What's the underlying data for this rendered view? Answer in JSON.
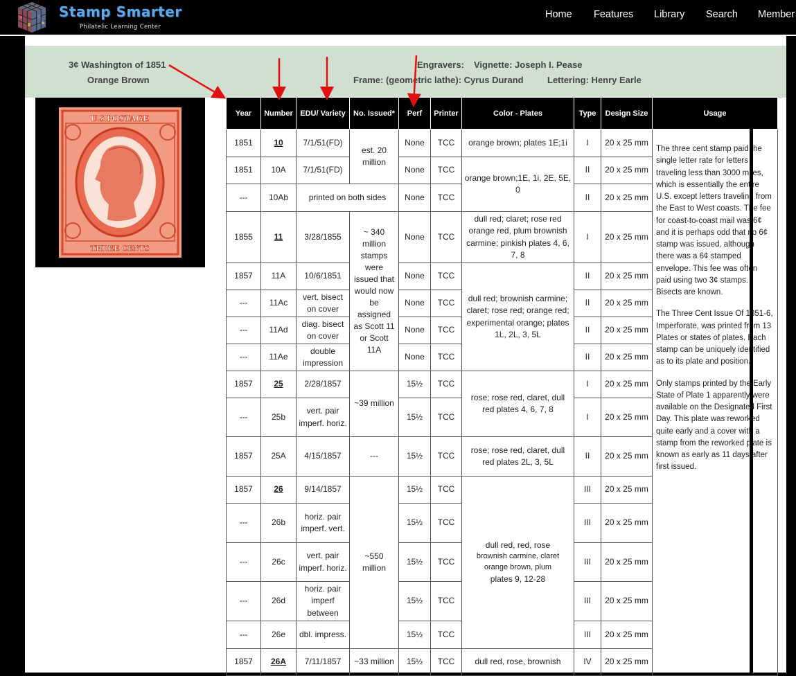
{
  "nav": {
    "brand": "Stamp Smarter",
    "tagline": "Philatelic Learning Center",
    "menu": [
      "Home",
      "Features",
      "Library",
      "Search",
      "Member"
    ]
  },
  "header": {
    "stamp_title": "3¢ Washington of 1851",
    "stamp_color": "Orange Brown",
    "engravers_label": "Engravers:",
    "vignette": "Vignette: Joseph I. Pease",
    "frame": "Frame: (geometric lathe): Cyrus Durand",
    "lettering": "Lettering: Henry Earle"
  },
  "stamp_image": {
    "top_text": "U.S.POSTAGE",
    "bottom_text": "THREE CENTS"
  },
  "table": {
    "headers": [
      "Year",
      "Number",
      "EDU/ Variety",
      "No. Issued*",
      "Perf",
      "Printer",
      "Color - Plates",
      "Type",
      "Design Size",
      "Usage"
    ],
    "rows": [
      {
        "year": "1851",
        "number": "10",
        "edu": "7/1/51(FD)",
        "perf": "None",
        "printer": "TCC",
        "type": "I",
        "size": "20 x 25 mm"
      },
      {
        "year": "1851",
        "number": "10A",
        "edu": "7/1/51(FD)",
        "perf": "None",
        "printer": "TCC",
        "type": "II",
        "size": "20 x 25 mm"
      },
      {
        "year": "---",
        "number": "10Ab",
        "edu": "printed on both sides",
        "perf": "None",
        "printer": "TCC",
        "type": "II",
        "size": "20 x 25 mm"
      },
      {
        "year": "1855",
        "number": "11",
        "edu": "3/28/1855",
        "perf": "None",
        "printer": "TCC",
        "type": "I",
        "size": "20 x 25 mm"
      },
      {
        "year": "1857",
        "number": "11A",
        "edu": "10/6/1851",
        "perf": "None",
        "printer": "TCC",
        "type": "II",
        "size": "20 x 25 mm"
      },
      {
        "year": "---",
        "number": "11Ac",
        "edu": "vert. bisect on cover",
        "perf": "None",
        "printer": "TCC",
        "type": "II",
        "size": "20 x 25 mm"
      },
      {
        "year": "---",
        "number": "11Ad",
        "edu": "diag. bisect on cover",
        "perf": "None",
        "printer": "TCC",
        "type": "II",
        "size": "20 x 25 mm"
      },
      {
        "year": "---",
        "number": "11Ae",
        "edu": "double impression",
        "perf": "None",
        "printer": "TCC",
        "type": "II",
        "size": "20 x 25 mm"
      },
      {
        "year": "1857",
        "number": "25",
        "edu": "2/28/1857",
        "perf": "15½",
        "printer": "TCC",
        "type": "I",
        "size": "20 x 25 mm"
      },
      {
        "year": "---",
        "number": "25b",
        "edu": "vert. pair imperf. horiz.",
        "perf": "15½",
        "printer": "TCC",
        "type": "I",
        "size": "20 x 25 mm"
      },
      {
        "year": "1857",
        "number": "25A",
        "edu": "4/15/1857",
        "issued": "---",
        "perf": "15½",
        "printer": "TCC",
        "type": "II",
        "size": "20 x 25 mm"
      },
      {
        "year": "1857",
        "number": "26",
        "edu": "9/14/1857",
        "perf": "15½",
        "printer": "TCC",
        "type": "III",
        "size": "20 x 25 mm"
      },
      {
        "year": "---",
        "number": "26b",
        "edu": "horiz. pair imperf. vert.",
        "perf": "15½",
        "printer": "TCC",
        "type": "III",
        "size": "20 x 25 mm"
      },
      {
        "year": "---",
        "number": "26c",
        "edu": "vert. pair imperf. horiz.",
        "perf": "15½",
        "printer": "TCC",
        "type": "III",
        "size": "20 x 25 mm"
      },
      {
        "year": "---",
        "number": "26d",
        "edu": "horiz. pair imperf between",
        "perf": "15½",
        "printer": "TCC",
        "type": "III",
        "size": "20 x 25 mm"
      },
      {
        "year": "---",
        "number": "26e",
        "edu": "dbl. impress.",
        "perf": "15½",
        "printer": "TCC",
        "type": "III",
        "size": "20 x 25 mm"
      },
      {
        "year": "1857",
        "number": "26A",
        "edu": "7/11/1857",
        "issued": "~33 million",
        "perf": "15½",
        "printer": "TCC",
        "type": "IV",
        "size": "20 x 25 mm"
      }
    ],
    "issued_groups": [
      "est. 20 million",
      "~ 340 million stamps were issued that would now be assigned as Scott 11 or Scott 11A",
      "~39 million",
      "~550 million"
    ],
    "color_groups": [
      "orange brown; plates 1E;1i",
      "orange brown;1E, 1i, 2E, 5E, 0",
      "dull red;  claret; rose red orange red, plum brownish carmine; pinkish plates 4, 6, 7, 8",
      "dull red; brownish carmine; claret; rose red; orange red; experimental orange;   plates 1L, 2L, 3, 5L",
      "rose; rose red, claret, dull red plates 4, 6, 7, 8",
      "rose; rose red, claret, dull red plates 2L, 3, 5L",
      {
        "line1": "dull red, red, rose",
        "line2": "brownish carmine, claret",
        "line3": "orange brown, plum",
        "line4": "plates 9, 12-28"
      },
      "dull red, rose, brownish"
    ],
    "usage": [
      "The three cent stamp paid the single letter rate for letters traveling less than 3000 miles, which is essentially the entire U.S. except letters traveling from the East to West coasts. The fee for coast-to-coast mail was 6¢ and it is perhaps odd that no 6¢ stamp was issued, although there was a 6¢ stamped envelope. This fee was often paid using two 3¢ stamps. Bisects are known.",
      "The Three Cent Issue Of 1851-6, Imperforate, was printed from 13 Plates or states of plates. Each stamp can be uniquely identified as to its plate and position.",
      "Only stamps printed by the Early State of Plate 1 apparently were available on the Designated First Day. This plate was reworked quite early and a cover with a stamp from the reworked plate is known as early as 11 days after first issued."
    ]
  },
  "colors": {
    "nav_bg": "#000000",
    "brand": "#5ea9e8",
    "banner_bg": "#d0dfd0",
    "annotation_arrow": "#e01010",
    "stamp": "#f29a82"
  }
}
